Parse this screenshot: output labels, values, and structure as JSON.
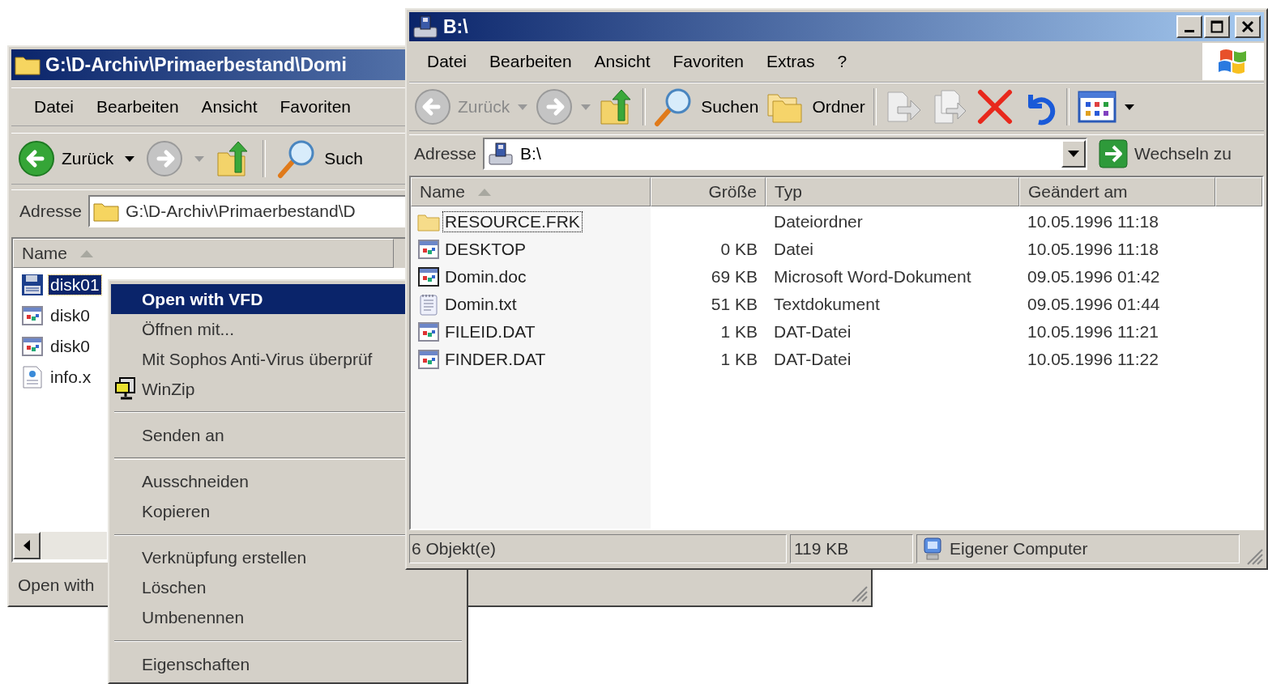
{
  "back_window": {
    "title": "G:\\D-Archiv\\Primaerbestand\\Domi",
    "menu": [
      "Datei",
      "Bearbeiten",
      "Ansicht",
      "Favoriten"
    ],
    "back": {
      "label": "Zurück",
      "disabled": false
    },
    "forward": {
      "disabled": true
    },
    "search_label": "Such",
    "address": {
      "label": "Adresse",
      "value": "G:\\D-Archiv\\Primaerbestand\\D"
    },
    "columns": [
      {
        "label": "Name",
        "sorted": true
      }
    ],
    "files": [
      {
        "name": "disk01",
        "kind": "vfd",
        "selected": true
      },
      {
        "name": "disk0",
        "kind": "app",
        "selected": false
      },
      {
        "name": "disk0",
        "kind": "app",
        "selected": false
      },
      {
        "name": "info.x",
        "kind": "xml",
        "selected": false
      }
    ],
    "status": "Open with"
  },
  "context_menu": {
    "items": [
      {
        "kind": "item",
        "label": "Open with VFD",
        "default": true,
        "selected": true
      },
      {
        "kind": "item",
        "label": "Öffnen mit...",
        "default": false,
        "selected": false
      },
      {
        "kind": "item",
        "label": "Mit Sophos Anti-Virus überprüf",
        "default": false,
        "selected": false
      },
      {
        "kind": "icon_item",
        "label": "WinZip",
        "default": false,
        "selected": false
      },
      {
        "kind": "separator"
      },
      {
        "kind": "item",
        "label": "Senden an",
        "default": false,
        "selected": false
      },
      {
        "kind": "separator"
      },
      {
        "kind": "item",
        "label": "Ausschneiden",
        "default": false,
        "selected": false
      },
      {
        "kind": "item",
        "label": "Kopieren",
        "default": false,
        "selected": false
      },
      {
        "kind": "separator"
      },
      {
        "kind": "item",
        "label": "Verknüpfung erstellen",
        "default": false,
        "selected": false
      },
      {
        "kind": "item",
        "label": "Löschen",
        "default": false,
        "selected": false
      },
      {
        "kind": "item",
        "label": "Umbenennen",
        "default": false,
        "selected": false
      },
      {
        "kind": "separator"
      },
      {
        "kind": "item",
        "label": "Eigenschaften",
        "default": false,
        "selected": false
      }
    ]
  },
  "front_window": {
    "title": "B:\\",
    "menu": [
      "Datei",
      "Bearbeiten",
      "Ansicht",
      "Favoriten",
      "Extras",
      "?"
    ],
    "back": {
      "label": "Zurück",
      "disabled": true
    },
    "forward": {
      "disabled": true
    },
    "search_label": "Suchen",
    "folders_label": "Ordner",
    "address": {
      "label": "Adresse",
      "value": "B:\\",
      "go_label": "Wechseln zu"
    },
    "columns": [
      {
        "label": "Name",
        "sorted": true
      },
      {
        "label": "Größe",
        "sorted": false
      },
      {
        "label": "Typ",
        "sorted": false
      },
      {
        "label": "Geändert am",
        "sorted": false
      }
    ],
    "rows": [
      {
        "name": "RESOURCE.FRK",
        "type": "Dateiordner",
        "modified": "10.05.1996 11:18",
        "kind": "folder",
        "focused": true
      },
      {
        "name": "DESKTOP",
        "size": "0 KB",
        "type": "Datei",
        "modified": "10.05.1996 11:18",
        "kind": "app",
        "focused": false
      },
      {
        "name": "Domin.doc",
        "size": "69 KB",
        "type": "Microsoft Word-Dokument",
        "modified": "09.05.1996 01:42",
        "kind": "word",
        "focused": false
      },
      {
        "name": "Domin.txt",
        "size": "51 KB",
        "type": "Textdokument",
        "modified": "09.05.1996 01:44",
        "kind": "text",
        "focused": false
      },
      {
        "name": "FILEID.DAT",
        "size": "1 KB",
        "type": "DAT-Datei",
        "modified": "10.05.1996 11:21",
        "kind": "app",
        "focused": false
      },
      {
        "name": "FINDER.DAT",
        "size": "1 KB",
        "type": "DAT-Datei",
        "modified": "10.05.1996 11:22",
        "kind": "app",
        "focused": false
      }
    ],
    "status": {
      "objects": "6 Objekt(e)",
      "size": "119 KB",
      "zone": "Eigener Computer"
    }
  }
}
